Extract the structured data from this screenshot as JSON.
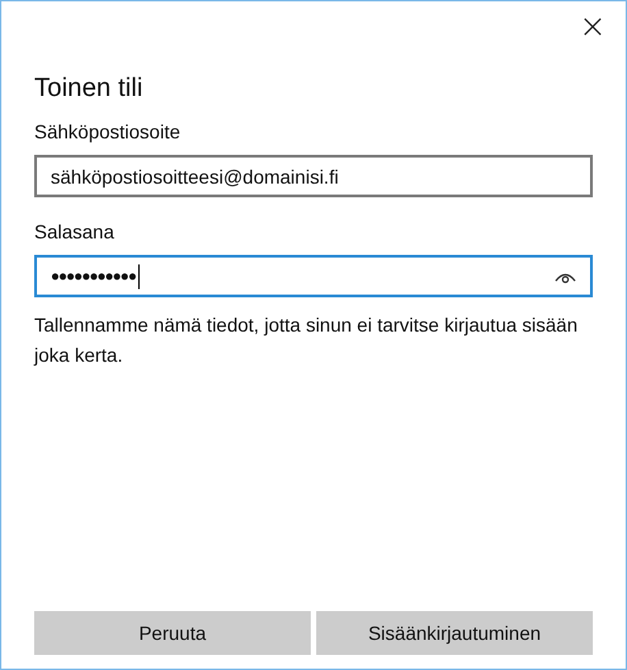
{
  "window": {
    "close": "×"
  },
  "title": "Toinen tili",
  "email": {
    "label": "Sähköpostiosoite",
    "value": "sähköpostiosoitteesi@domainisi.fi",
    "focused": false
  },
  "password": {
    "label": "Salasana",
    "value": "●●●●●●●●●●●",
    "focused": true
  },
  "note": "Tallennamme nämä tiedot, jotta sinun ei tarvitse kirjautua sisään joka kerta.",
  "buttons": [
    "Peruuta",
    "Sisäänkirjautuminen"
  ]
}
